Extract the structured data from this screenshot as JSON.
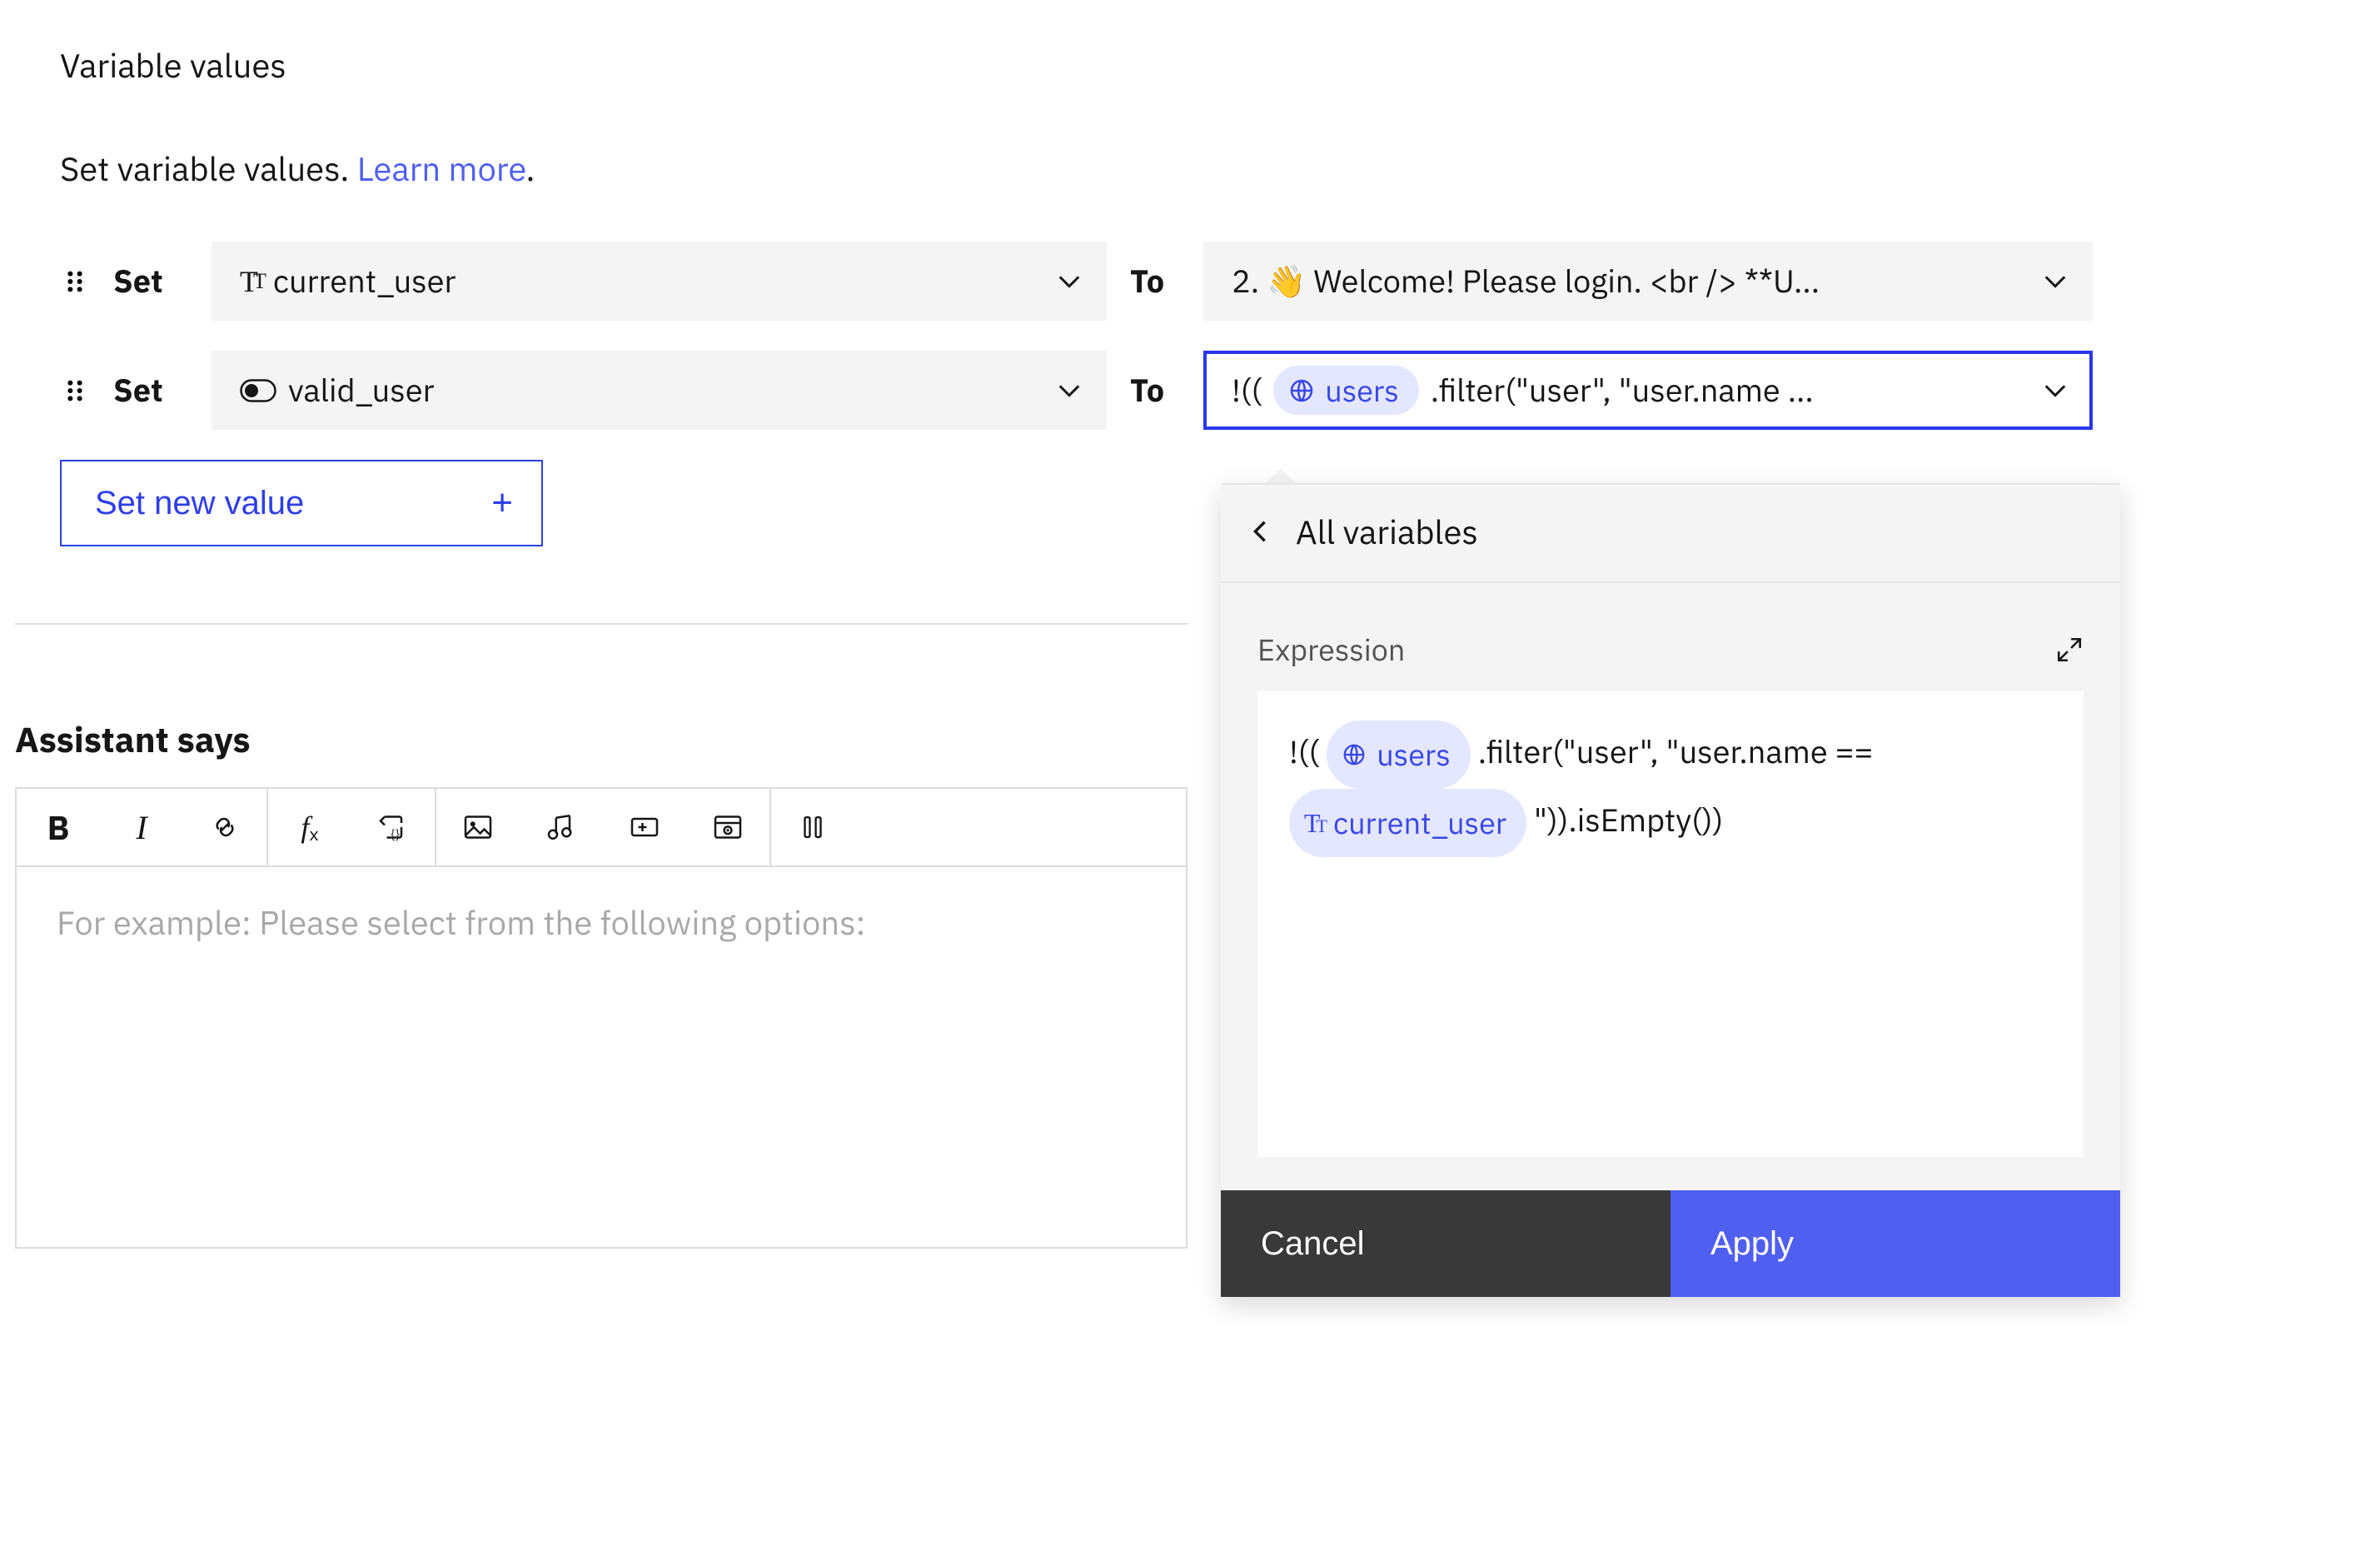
{
  "heading": "Variable values",
  "subtitle_prefix": "Set variable values. ",
  "learn_more": "Learn more",
  "period": ".",
  "labels": {
    "set": "Set",
    "to": "To"
  },
  "rows": [
    {
      "variable": {
        "type_icon": "text",
        "name": "current_user"
      },
      "value_display": "2. 👋 Welcome! Please login. <br /> **U..."
    },
    {
      "variable": {
        "type_icon": "boolean",
        "name": "valid_user"
      },
      "value_focused": true,
      "value_expr": {
        "prefix": "!(( ",
        "chip": {
          "icon": "globe",
          "text": "users"
        },
        "suffix": ".filter(\"user\", \"user.name ..."
      }
    }
  ],
  "set_new_value": "Set new value",
  "assistant_says": "Assistant says",
  "editor_placeholder": "For example: Please select from the following options:",
  "popover": {
    "breadcrumb": "All variables",
    "label": "Expression",
    "expression": {
      "p1": "!(( ",
      "chip_users": {
        "icon": "globe",
        "text": "users"
      },
      "p2": ".filter(\"user\", \"user.name == ",
      "chip_current": {
        "icon": "text",
        "text": "current_user"
      },
      "p3": "\")).isEmpty())"
    },
    "cancel": "Cancel",
    "apply": "Apply"
  }
}
